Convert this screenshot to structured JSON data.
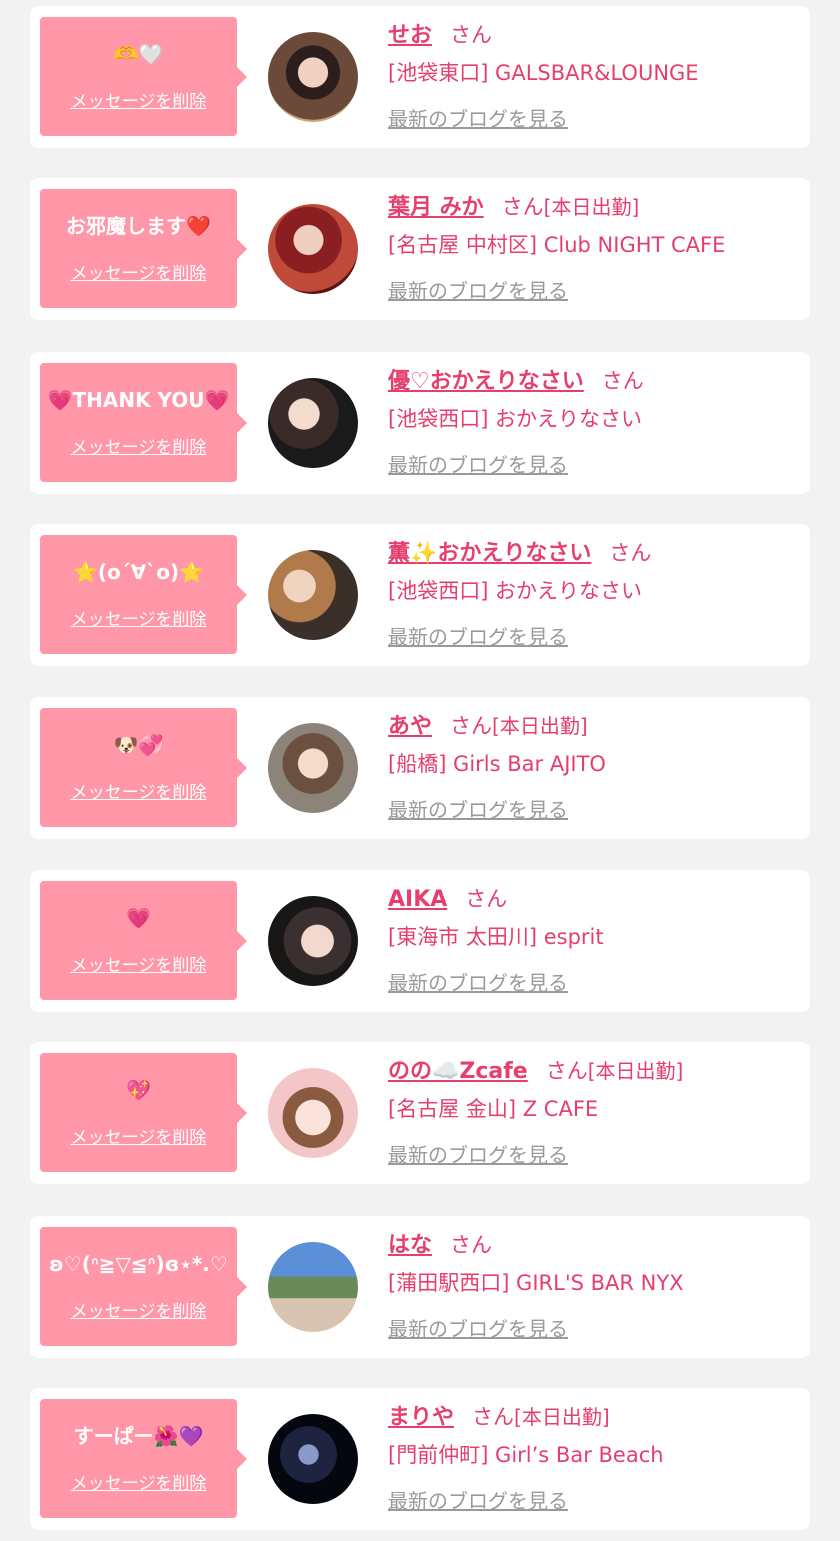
{
  "delete_label": "メッセージを削除",
  "blog_label": "最新のブログを見る",
  "san_label": "さん",
  "colors": {
    "accent": "#e63e6d",
    "bubble": "#ff97a9",
    "card": "#ffffff",
    "background": "#f2f2f2",
    "link_gray": "#9a9a9a"
  },
  "entries": [
    {
      "message": "🫶🤍",
      "name": "せお",
      "shift": "",
      "shop": "[池袋東口] GALSBAR&LOUNGE"
    },
    {
      "message": "お邪魔します❤️",
      "name": "葉月 みか",
      "shift": "[本日出勤]",
      "shop": "[名古屋 中村区] Club NIGHT CAFE"
    },
    {
      "message": "💗THANK YOU💗",
      "name": "優♡おかえりなさい",
      "shift": "",
      "shop": "[池袋西口] おかえりなさい"
    },
    {
      "message": "⭐️(oˊ∀ˋo)⭐️",
      "name": "薫✨おかえりなさい",
      "shift": "",
      "shop": "[池袋西口] おかえりなさい"
    },
    {
      "message": "🐶💞",
      "name": "あや",
      "shift": "[本日出勤]",
      "shop": "[船橋] Girls Bar AJITO"
    },
    {
      "message": "💗",
      "name": "AIKA",
      "shift": "",
      "shop": "[東海市 太田川] esprit"
    },
    {
      "message": "💖",
      "name": "のの☁️Zcafe",
      "shift": "[本日出勤]",
      "shop": "[名古屋 金山] Z CAFE"
    },
    {
      "message": "ʚ♡(ᐢ≧▽≦ᐢ)ɞ⋆*.♡",
      "name": "はな",
      "shift": "",
      "shop": "[蒲田駅西口] GIRL'S BAR NYX"
    },
    {
      "message": "すーぱー🌺💜",
      "name": "まりや",
      "shift": "[本日出勤]",
      "shop": "[門前仲町] Girl’s Bar Beach"
    }
  ]
}
